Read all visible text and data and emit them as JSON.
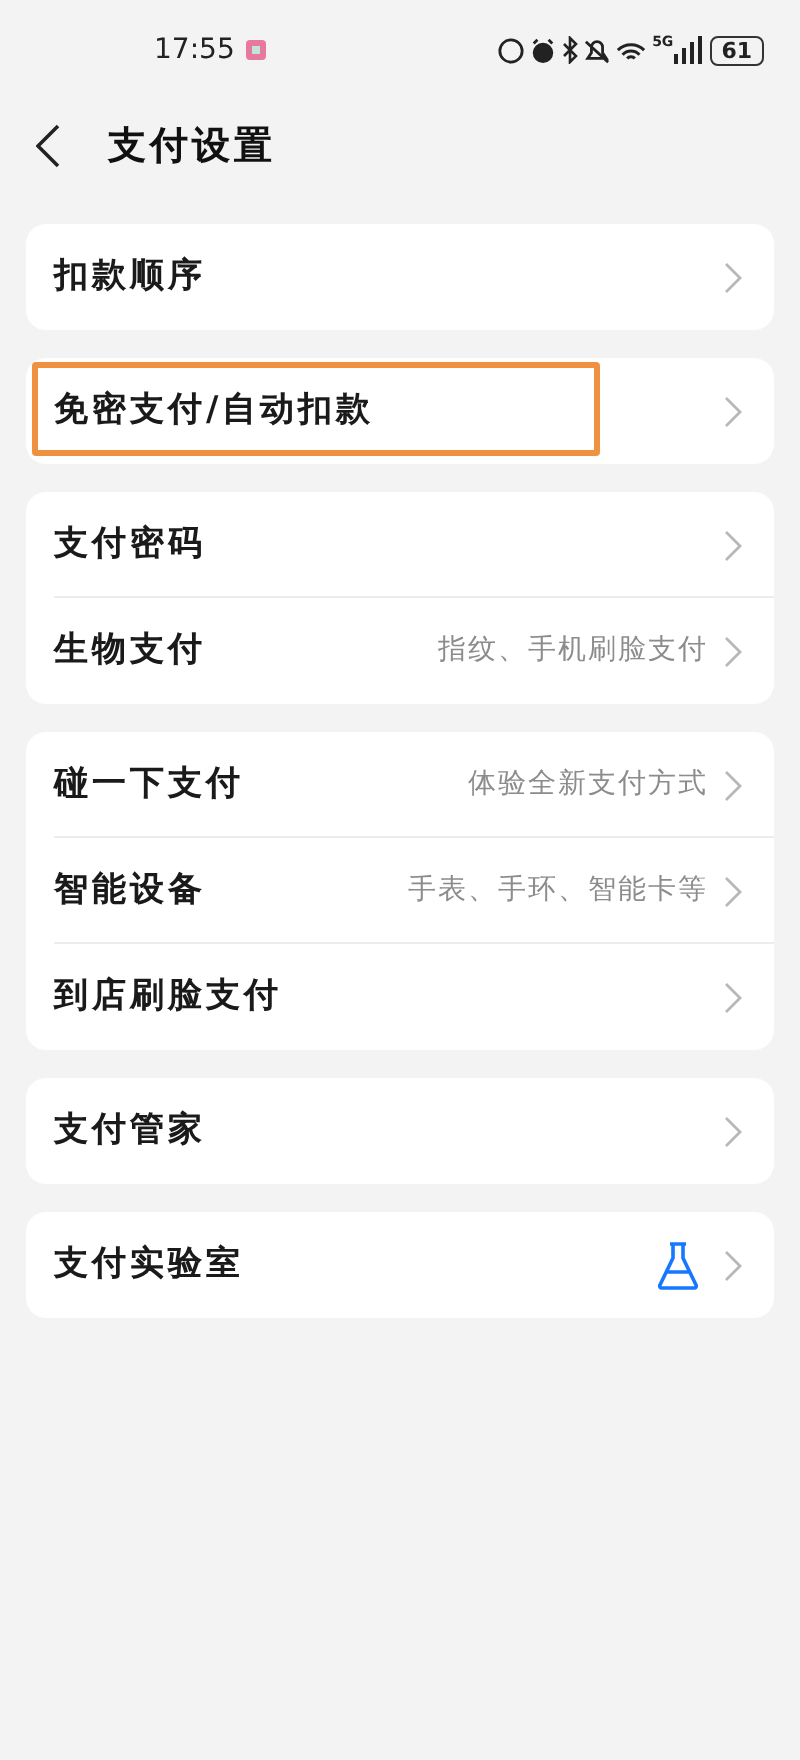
{
  "status_bar": {
    "time": "17:55",
    "network": "5G",
    "battery": "61"
  },
  "header": {
    "title": "支付设置"
  },
  "groups": [
    {
      "items": [
        {
          "label": "扣款顺序",
          "highlighted": false
        }
      ]
    },
    {
      "items": [
        {
          "label": "免密支付/自动扣款",
          "highlighted": true
        }
      ]
    },
    {
      "items": [
        {
          "label": "支付密码",
          "highlighted": false
        },
        {
          "label": "生物支付",
          "hint": "指纹、手机刷脸支付",
          "highlighted": false
        }
      ]
    },
    {
      "items": [
        {
          "label": "碰一下支付",
          "hint": "体验全新支付方式",
          "highlighted": false
        },
        {
          "label": "智能设备",
          "hint": "手表、手环、智能卡等",
          "highlighted": false
        },
        {
          "label": "到店刷脸支付",
          "highlighted": false
        }
      ]
    },
    {
      "items": [
        {
          "label": "支付管家",
          "highlighted": false
        }
      ]
    },
    {
      "items": [
        {
          "label": "支付实验室",
          "kind": "icon_link",
          "highlighted": false
        }
      ]
    }
  ]
}
